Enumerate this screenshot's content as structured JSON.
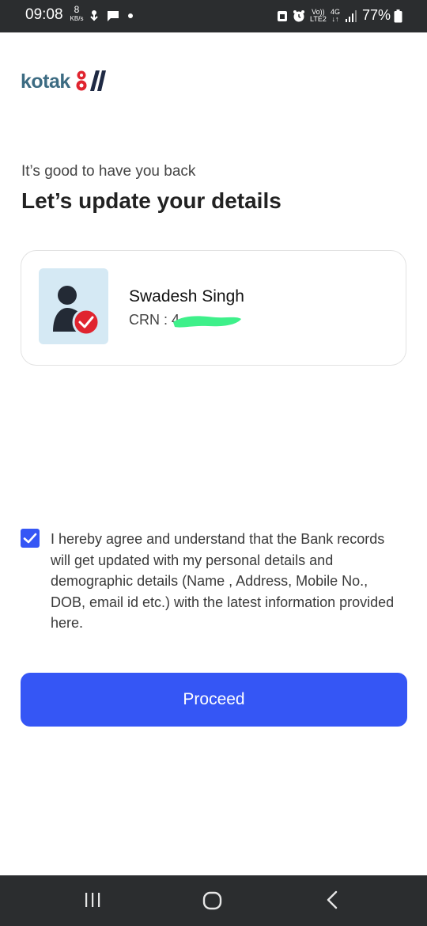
{
  "status_bar": {
    "time": "09:08",
    "data_speed_value": "8",
    "data_speed_unit": "KB/s",
    "network_label_top": "Vo))",
    "network_label_bottom": "LTE2",
    "network_type": "4G",
    "battery_percent": "77%",
    "icons": [
      "usb-icon",
      "chat-icon",
      "notification-dot-icon",
      "alarm-icon",
      "alarm-clock-icon",
      "signal-icon",
      "battery-icon"
    ]
  },
  "brand": {
    "name": "kotak",
    "accent_color": "#e0242f",
    "text_color": "#3c6b82"
  },
  "greeting": "It’s good to have you back",
  "title": "Let’s update your details",
  "profile": {
    "name": "Swadesh Singh",
    "crn_label": "CRN : 4",
    "avatar_icon": "user-verified-icon"
  },
  "consent": {
    "checked": true,
    "text": "I hereby agree and understand that the Bank records will get updated with my personal details and demographic details (Name , Address, Mobile No., DOB, email id etc.) with the latest information provided here."
  },
  "actions": {
    "proceed_label": "Proceed",
    "primary_color": "#3556f5"
  },
  "nav_bar": {
    "buttons": [
      "recent-apps-icon",
      "home-icon",
      "back-icon"
    ]
  }
}
